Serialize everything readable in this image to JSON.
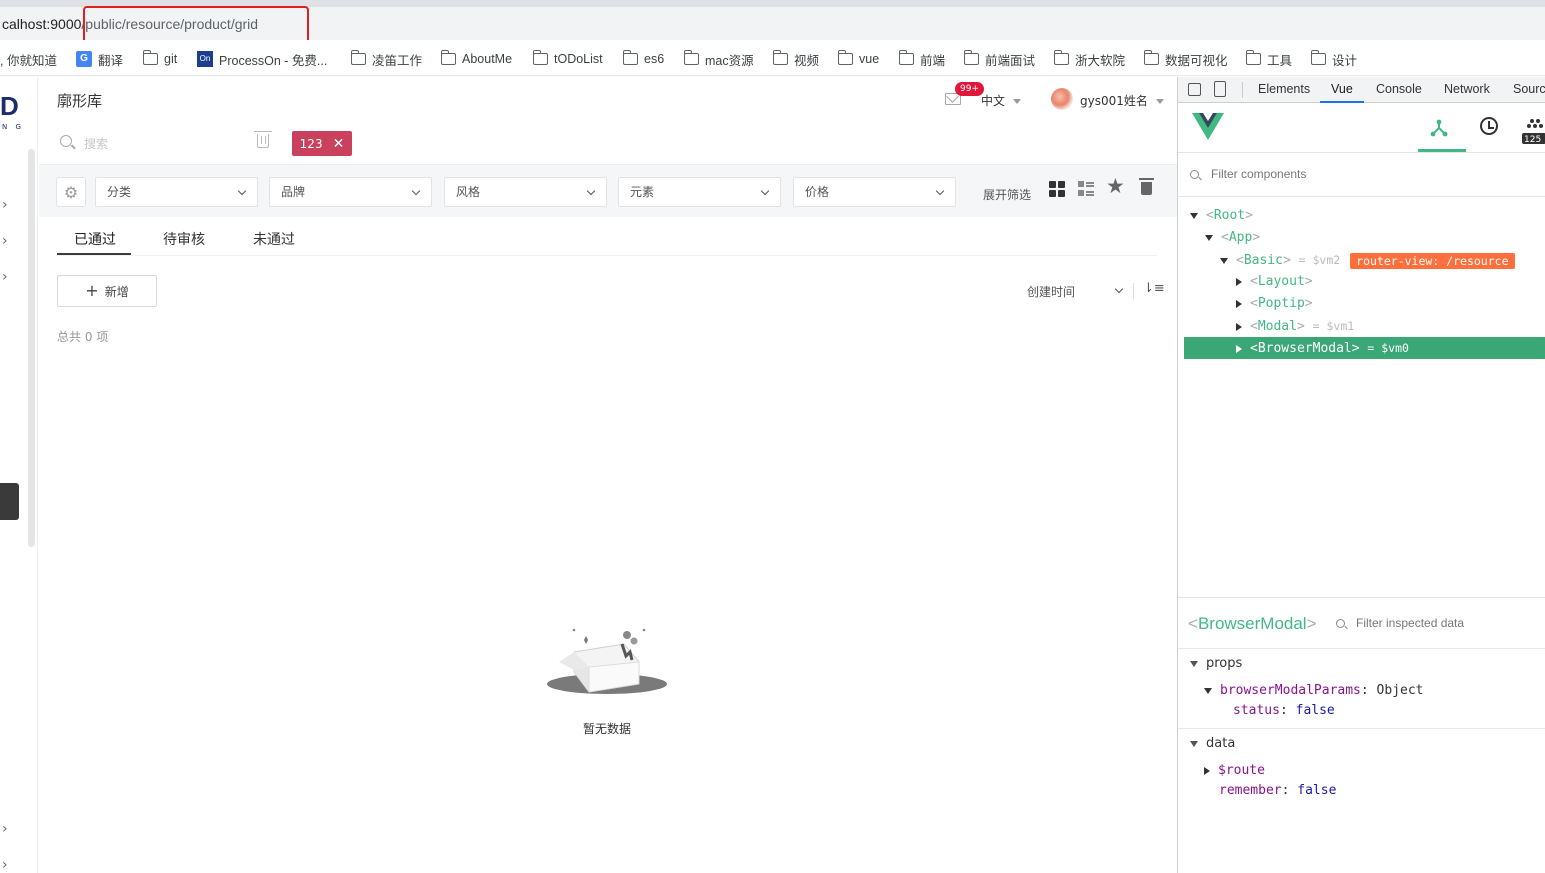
{
  "browser": {
    "url_host": "calhost:9000",
    "url_path": "/public/resource/product/grid",
    "bookmarks": [
      {
        "label": ", 你就知道",
        "icon": "none"
      },
      {
        "label": "翻译",
        "icon": "google-translate-icon"
      },
      {
        "label": "git",
        "icon": "folder-icon"
      },
      {
        "label": "ProcessOn - 免费...",
        "icon": "processon-icon"
      },
      {
        "label": "凌笛工作",
        "icon": "folder-icon"
      },
      {
        "label": "AboutMe",
        "icon": "folder-icon"
      },
      {
        "label": "tODoList",
        "icon": "folder-icon"
      },
      {
        "label": "es6",
        "icon": "folder-icon"
      },
      {
        "label": "mac资源",
        "icon": "folder-icon"
      },
      {
        "label": "视频",
        "icon": "folder-icon"
      },
      {
        "label": "vue",
        "icon": "folder-icon"
      },
      {
        "label": "前端",
        "icon": "folder-icon"
      },
      {
        "label": "前端面试",
        "icon": "folder-icon"
      },
      {
        "label": "浙大软院",
        "icon": "folder-icon"
      },
      {
        "label": "数据可视化",
        "icon": "folder-icon"
      },
      {
        "label": "工具",
        "icon": "folder-icon"
      },
      {
        "label": "设计",
        "icon": "folder-icon"
      }
    ]
  },
  "app": {
    "logo_letter": "D",
    "logo_sub": "N G",
    "title": "廓形库",
    "mail_badge": "99+",
    "language": "中文",
    "username": "gys001姓名",
    "search": {
      "placeholder": "搜索"
    },
    "tag_chip": "123",
    "filters": [
      "分类",
      "品牌",
      "风格",
      "元素",
      "价格"
    ],
    "expand_filter": "展开筛选",
    "tabs": [
      {
        "label": "已通过",
        "active": true
      },
      {
        "label": "待审核",
        "active": false
      },
      {
        "label": "未通过",
        "active": false
      }
    ],
    "add_button": "新增",
    "sort_by": "创建时间",
    "total": "总共 0 项",
    "empty_text": "暂无数据",
    "colors": {
      "tag": "#c9415d",
      "badge": "#e0173b"
    }
  },
  "devtools": {
    "tabs": [
      "Elements",
      "Vue",
      "Console",
      "Network",
      "Sourc"
    ],
    "active_tab": "Vue",
    "perf_count": "125",
    "filter_components_placeholder": "Filter components",
    "tree": [
      {
        "lt": "<",
        "name": "Root",
        "gt": ">",
        "vm": "",
        "badge": "",
        "expanded": true
      },
      {
        "lt": "<",
        "name": "App",
        "gt": ">",
        "vm": "",
        "badge": "",
        "expanded": true
      },
      {
        "lt": "<",
        "name": "Basic",
        "gt": ">",
        "vm": "= $vm2",
        "badge": "router-view: /resource",
        "expanded": true
      },
      {
        "lt": "<",
        "name": "Layout",
        "gt": ">",
        "vm": "",
        "badge": "",
        "expanded": false
      },
      {
        "lt": "<",
        "name": "Poptip",
        "gt": ">",
        "vm": "",
        "badge": "",
        "expanded": false
      },
      {
        "lt": "<",
        "name": "Modal",
        "gt": ">",
        "vm": "= $vm1",
        "badge": "",
        "expanded": false
      },
      {
        "lt": "<",
        "name": "BrowserModal",
        "gt": ">",
        "vm": "= $vm0",
        "badge": "",
        "expanded": false,
        "selected": true
      }
    ],
    "inspector": {
      "lt": "<",
      "component": "BrowserModal",
      "gt": ">",
      "filter_placeholder": "Filter inspected data",
      "props_label": "props",
      "props_key": "browserModalParams",
      "props_colon": ":",
      "props_type": "Object",
      "status_key": "status",
      "status_colon": ":",
      "status_val": "false",
      "data_label": "data",
      "route_key": "$route",
      "remember_key": "remember",
      "remember_colon": ":",
      "remember_val": "false"
    },
    "colors": {
      "vue_green": "#42b883",
      "selected_row": "#3ba776",
      "router_badge": "#ff6f3c"
    }
  }
}
